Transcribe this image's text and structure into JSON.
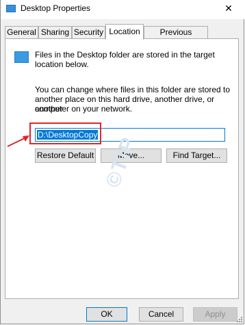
{
  "window": {
    "title": "Desktop Properties",
    "close_glyph": "✕"
  },
  "tabs": [
    {
      "label": "General"
    },
    {
      "label": "Sharing"
    },
    {
      "label": "Security"
    },
    {
      "label": "Location"
    },
    {
      "label": "Previous Versions"
    }
  ],
  "location": {
    "intro_line1": "Files in the Desktop folder are stored in the target",
    "intro_line2": "location below.",
    "desc_line1": "You can change where files in this folder are stored to",
    "desc_line2": "another place on this hard drive, another drive, or another",
    "desc_line3": "computer on your network.",
    "path_value": "D:\\DesktopCopy",
    "restore_label": "Restore Default",
    "move_label": "Move...",
    "find_label": "Find Target..."
  },
  "footer": {
    "ok_label": "OK",
    "cancel_label": "Cancel",
    "apply_label": "Apply"
  },
  "watermark": "©TIP",
  "colors": {
    "accent": "#0078d7",
    "highlight": "#e0262b",
    "folder": "#3b9be0"
  },
  "icons": {
    "title": "folder-icon",
    "folder": "desktop-folder-icon",
    "close": "close-icon"
  }
}
